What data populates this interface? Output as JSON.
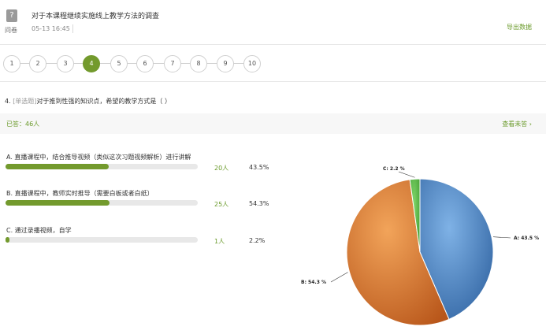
{
  "header": {
    "type_label": "问卷",
    "title": "对于本课程继续实施线上教学方法的调查",
    "time": "05-13 16:45",
    "export_label": "导出数据"
  },
  "pager": {
    "pages": [
      "1",
      "2",
      "3",
      "4",
      "5",
      "6",
      "7",
      "8",
      "9",
      "10"
    ],
    "active": "4"
  },
  "question": {
    "number": "4.",
    "type": "[单选题]",
    "text": "对于推到性强的知识点，希望的教学方式是（ ）"
  },
  "answered": {
    "label": "已答：46人",
    "view_unanswered": "查看未答 ›"
  },
  "options": [
    {
      "label": "A. 直播课程中，结合推导视频（类似这次习题视频解析）进行讲解",
      "count": "20人",
      "percent": "43.5%",
      "fraction": 0.435
    },
    {
      "label": "B. 直播课程中，教师实时推导（需要白板或者白纸）",
      "count": "25人",
      "percent": "54.3%",
      "fraction": 0.543
    },
    {
      "label": "C. 通过录播视频，自学",
      "count": "1人",
      "percent": "2.2%",
      "fraction": 0.022
    }
  ],
  "chart_data": {
    "type": "pie",
    "slices": [
      {
        "label": "A: 43.5 %",
        "value": 43.5,
        "color": "#4f86c6"
      },
      {
        "label": "B: 54.3 %",
        "value": 54.3,
        "color": "#e07a2a"
      },
      {
        "label": "C: 2.2 %",
        "value": 2.2,
        "color": "#5fbf4a"
      }
    ]
  },
  "colors": {
    "accent": "#739a2d",
    "track": "#e8e8e8"
  }
}
